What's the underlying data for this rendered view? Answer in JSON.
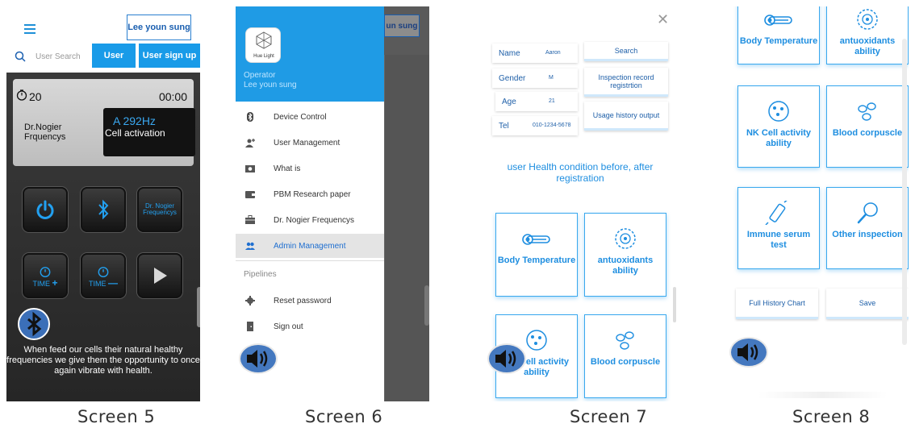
{
  "captions": [
    "Screen 5",
    "Screen 6",
    "Screen 7",
    "Screen 8"
  ],
  "colors": {
    "accent": "#199be8",
    "heading": "#1e8ee0",
    "speaker": "#4478bf"
  },
  "screen5": {
    "user_button": "Lee youn sung",
    "search_placeholder": "User Search",
    "user_tab": "User",
    "signup_tab": "User sign up",
    "timer_count": "20",
    "timer_time": "00:00",
    "mode_label_line1": "Dr.Nogier",
    "mode_label_line2": "Frquencys",
    "frequency": "A 292Hz",
    "mode": "Cell activation",
    "nogier_button_line1": "Dr. Nogier",
    "nogier_button_line2": "Frequencys",
    "time_plus": "TIME",
    "time_minus": "TIME",
    "tagline": "When feed our cells their natural healthy frequencies we give them the opportunity to once again vibrate with health."
  },
  "screen6": {
    "bg_button": "un sung",
    "logo_text": "Hue Light",
    "operator_label": "Operator",
    "operator_name": "Lee youn sung",
    "menu": [
      {
        "label": "Device Control",
        "icon": "bluetooth-icon"
      },
      {
        "label": "User Management",
        "icon": "user-add-icon"
      },
      {
        "label": "What is",
        "icon": "camera-icon"
      },
      {
        "label": "PBM Research paper",
        "icon": "wallet-icon"
      },
      {
        "label": "Dr. Nogier Frequencys",
        "icon": "briefcase-icon"
      },
      {
        "label": "Admin Management",
        "icon": "users-icon"
      }
    ],
    "section_label": "Pipelines",
    "pipelines": [
      {
        "label": "Reset password",
        "icon": "gear-icon"
      },
      {
        "label": "Sign out",
        "icon": "door-icon"
      }
    ]
  },
  "screen7": {
    "fields": [
      {
        "key": "Name",
        "value": "Aaron"
      },
      {
        "key": "Gender",
        "value": "M"
      },
      {
        "key": "Age",
        "value": "21"
      },
      {
        "key": "Tel",
        "value": "010-1234-5678"
      }
    ],
    "search_button": "Search",
    "inspection_button": "Inspection record registrtion",
    "usage_button": "Usage history output",
    "heading": "user Health condition before, after registration",
    "cards": [
      {
        "label": "Body Temperature",
        "icon": "thermometer-icon"
      },
      {
        "label": "antuoxidants ability",
        "icon": "cell-icon"
      },
      {
        "label": "NK Cell activity ability",
        "icon": "nk-cell-icon"
      },
      {
        "label": "Blood corpuscle",
        "icon": "blood-cells-icon"
      }
    ]
  },
  "screen8": {
    "cards": [
      {
        "label": "Body Temperature",
        "icon": "thermometer-icon"
      },
      {
        "label": "antuoxidants ability",
        "icon": "cell-icon"
      },
      {
        "label": "NK Cell activity ability",
        "icon": "nk-cell-icon"
      },
      {
        "label": "Blood corpuscle",
        "icon": "blood-cells-icon"
      },
      {
        "label": "Immune serum test",
        "icon": "syringe-icon"
      },
      {
        "label": "Other inspection",
        "icon": "magnifier-icon"
      }
    ],
    "full_history_button": "Full History Chart",
    "save_button": "Save"
  }
}
